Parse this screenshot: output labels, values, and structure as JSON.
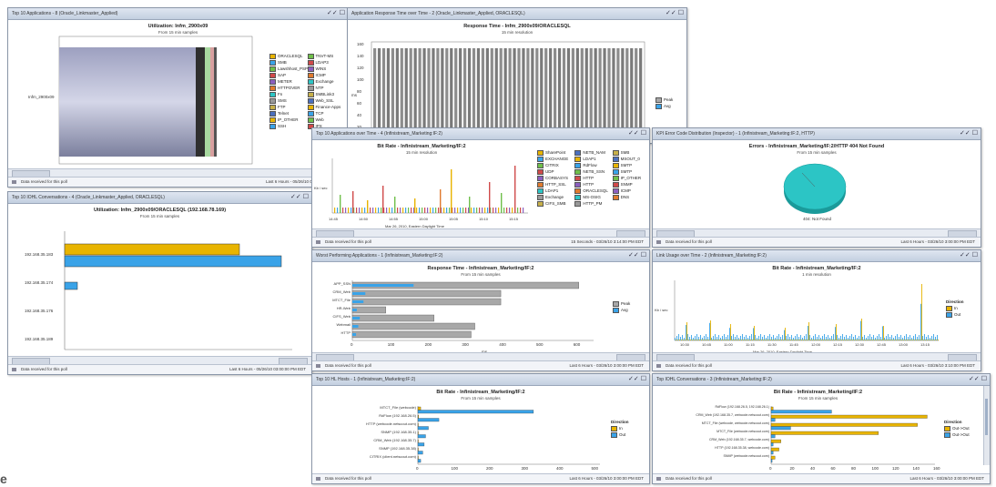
{
  "colors": {
    "gold": "#e8b400",
    "blue": "#3aa3e8",
    "gray": "#a8a8a8",
    "cyan": "#2cc5c5",
    "title": "#c3cfe0"
  },
  "status_text": "Data received for this poll",
  "p1": {
    "title": "Top 10 Applications - 8 (Oracle_Linkmaster_Applied)",
    "chart_title": "Utilization: Infm_2900x09",
    "chart_sub": "From 15 min samples",
    "ylabel": "Infm_2900x09",
    "xticks": [
      "0.00%",
      "0.01%",
      "0.02%",
      "0.03%",
      "0.04%",
      "0.05%"
    ],
    "legend": [
      "ORACLESQL",
      "SMB",
      "Lawshhost_PSP",
      "SAP",
      "METER",
      "HTTPOVER",
      "Fn",
      "SMS",
      "FTP",
      "Telnet",
      "IP_OTHER",
      "SSH",
      "TNVT-MS",
      "LDAP3",
      "WINS",
      "ICMP",
      "Exchange",
      "NTP",
      "SMBLink3",
      "Web_SSL",
      "Finance-Apps",
      "TCP",
      "Web",
      "IPX"
    ],
    "last": "Last 6 Hours - 05/26/10 03:00:00 PM EDT"
  },
  "p2": {
    "title": "Application Response Time over Time - 2 (Oracle_Linkmaster_Applied, ORACLESQL)",
    "chart_title": "Response Time - Infm_2900x09/ORACLESQL",
    "chart_sub": "15 min resolution",
    "ylabel": "ms",
    "yticks": [
      "160",
      "140",
      "120",
      "100",
      "80",
      "60",
      "40",
      "20",
      "0"
    ],
    "legend": [
      "Peak",
      "Avg"
    ]
  },
  "p3": {
    "title": "Top 10 IOHL Conversations - 4 (Oracle_Linkmaster_Applied, ORACLESQL)",
    "chart_title": "Utilization: Infm_2900x09/ORACLESQL (192.168.78.169)",
    "chart_sub": "From 15 min samples",
    "rows": [
      "192.168.35.183",
      "192.168.35.174",
      "192.168.35.176",
      "192.168.35.189"
    ],
    "xticks": [
      "0.00%",
      "0.01%",
      "0.02%"
    ],
    "last": "Last 6 Hours - 05/26/10 03:00:00 PM EDT"
  },
  "p4": {
    "title": "Top 10 Applications over Time - 4 (Infinistream_Marketing:IF:2)",
    "chart_title": "Bit Rate - Infinistream_Marketing/IF:2",
    "chart_sub": "15 min resolution",
    "ylabel": "Kb / sec",
    "xlabel": "Mar 26, 2010, Eastern Daylight Time",
    "xticks": [
      "14:45",
      "14:50",
      "14:55",
      "15:00",
      "15:05",
      "15:10",
      "15:15"
    ],
    "legend": [
      "SharePoint",
      "EXCHANGE",
      "CITRIX",
      "UDP",
      "CORBASYS",
      "HTTP_SSL",
      "LDAP1",
      "Exchange",
      "CIFS_SMB",
      "NETB_NAM",
      "LDAP1",
      "RdFlow",
      "NETB_SSN",
      "HTTP",
      "HTTP",
      "ORACLESQL",
      "MS-OSIG",
      "HTTP_PM",
      "SMB",
      "MSOUT_0",
      "SMTP",
      "SMTP",
      "IP_OTHER",
      "SNMP",
      "ICMP",
      "DNS"
    ],
    "last": "15 Seconds - 03/26/10 3:14:00 PM EDT"
  },
  "p5": {
    "title": "KPI Error Code Distribution (Inspector) - 1 (Infinistream_Marketing:IF:2, HTTP)",
    "chart_title": "Errors - Infinistream_Marketing/IF:2/HTTP 404 Not Found",
    "chart_sub": "From 15 min samples",
    "pie_label": "404: Not Found",
    "last": "Last 6 Hours - 03/26/10 3:00:00 PM EDT"
  },
  "p6": {
    "title": "Worst Performing Applications - 1 (Infinistream_Marketing:IF:2)",
    "chart_title": "Response Time - Infinistream_Marketing/IF:2",
    "chart_sub": "From 15 min samples",
    "rows": [
      "APP_SSN",
      "CRM_Web",
      "MTCT_File",
      "HR-Web",
      "CIFS_Web",
      "Webmail",
      "HTTP"
    ],
    "xlabel": "ms",
    "xticks": [
      "0",
      "100",
      "200",
      "300",
      "400",
      "500",
      "600"
    ],
    "legend": [
      "Peak",
      "Avg"
    ],
    "last": "Last 6 Hours - 03/26/10 3:00:00 PM EDT"
  },
  "p7": {
    "title": "Link Usage over Time - 2 (Infinistream_Marketing:IF:2)",
    "chart_title": "Bit Rate - Infinistream_Marketing/IF:2",
    "chart_sub": "1 min resolution",
    "ylabel": "Kb / sec",
    "xlabel": "Mar 26, 2010, Eastern Daylight Time",
    "xticks": [
      "10:30",
      "10:45",
      "11:00",
      "11:15",
      "11:30",
      "11:45",
      "12:00",
      "12:15",
      "12:30",
      "12:45",
      "13:00",
      "13:15"
    ],
    "legend_title": "Direction",
    "legend": [
      "In",
      "Out"
    ],
    "last": "Last 6 Hours - 03/26/10 3:10:00 PM EDT"
  },
  "p8": {
    "title": "Top 10 HL Hosts - 1 (Infinistream_Marketing:IF:2)",
    "chart_title": "Bit Rate - Infinistream_Marketing/IF:2",
    "chart_sub": "From 15 min samples",
    "rows": [
      "MTCT_File (webcode)",
      "RdFlow (192.168.26.5)",
      "HTTP (webcode.netscout.com)",
      "SNMP (192.168.35.1)",
      "CRM_Web (192.168.35.7)",
      "SNMP (192.168.35.38)",
      "CITRIX (client.netscout.com)"
    ],
    "xlabel": "Kb / sec",
    "xticks": [
      "0",
      "100",
      "200",
      "300",
      "400",
      "500"
    ],
    "legend_title": "Direction",
    "legend": [
      "In",
      "Out"
    ],
    "last": "Last 6 Hours - 03/26/10 3:00:00 PM EDT"
  },
  "p9": {
    "title": "Top IOHL Conversations - 3 (Infinistream_Marketing:IF:2)",
    "chart_title": "Bit Rate - Infinistream_Marketing/IF:2",
    "chart_sub": "From 15 min samples",
    "rows": [
      "RdFlow (192.168.26.5, 192.168.26.1)",
      "CRM_Web (192.168.35.7, webcode.netscout.com)",
      "MTCT_File (webcode, webcode.netscout.com)",
      "MTCT_File (webcode.netscout.com)",
      "CRM_Web (192.168.35.7, webcode.com)",
      "HTTP (192.168.35.38, webcode.com)",
      "SNMP (webcode.netscout.com)"
    ],
    "xlabel": "Kb / sec",
    "xticks": [
      "0",
      "20",
      "40",
      "60",
      "80",
      "100",
      "120",
      "140",
      "160"
    ],
    "legend_title": "Direction",
    "legend": [
      "Out->Out",
      "Out->Out"
    ],
    "last": "Last 6 Hours - 03/26/10 3:00:00 PM EDT"
  },
  "orphan": "e"
}
